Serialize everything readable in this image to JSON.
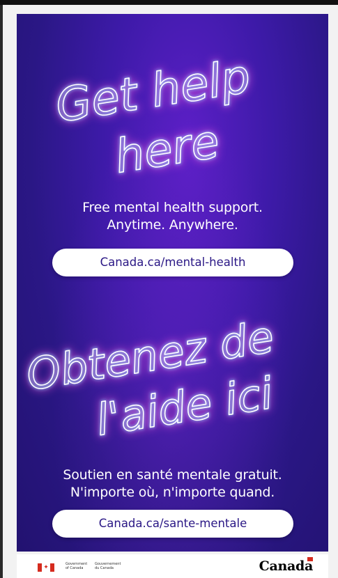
{
  "poster": {
    "headline_en_line1": "Get help",
    "headline_en_line2": "here",
    "tagline_en_line1": "Free mental health support.",
    "tagline_en_line2": "Anytime. Anywhere.",
    "link_en": "Canada.ca/mental-health",
    "headline_fr_line1": "Obtenez de",
    "headline_fr_line2": "l'aide ici",
    "tagline_fr_line1": "Soutien en santé mentale gratuit.",
    "tagline_fr_line2": "N'importe où, n'importe quand.",
    "link_fr": "Canada.ca/sante-mentale"
  },
  "footer": {
    "gov_en_line1": "Government",
    "gov_en_line2": "of Canada",
    "gov_fr_line1": "Gouvernement",
    "gov_fr_line2": "du Canada",
    "wordmark": "Canada"
  },
  "colors": {
    "background_purple": "#3d1aa8",
    "neon_pink": "#ff5ce0",
    "neon_cyan": "#7fd8ff",
    "link_text": "#2a1785",
    "flag_red": "#d52b1e"
  },
  "icons": {
    "flag": "canada-flag-icon",
    "maple_leaf": "maple-leaf-icon"
  }
}
